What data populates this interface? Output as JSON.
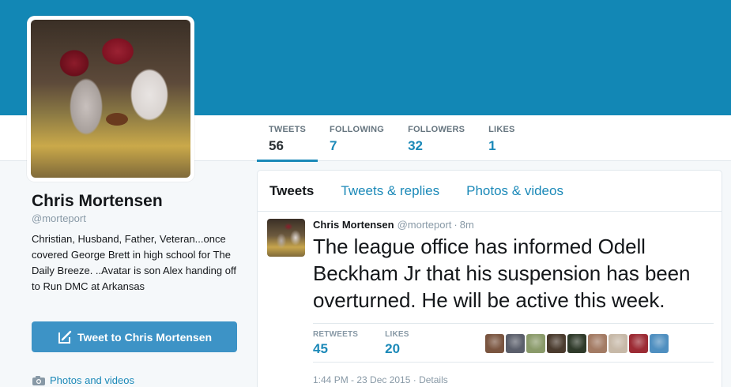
{
  "profile": {
    "name": "Chris Mortensen",
    "handle": "@morteport",
    "bio": "Christian, Husband, Father, Veteran...once covered George Brett in high school for The Daily Breeze. ..Avatar is son Alex handing off to Run DMC at Arkansas",
    "tweet_to_label": "Tweet to Chris Mortensen",
    "photos_link": "Photos and videos"
  },
  "stats": [
    {
      "label": "TWEETS",
      "value": "56"
    },
    {
      "label": "FOLLOWING",
      "value": "7"
    },
    {
      "label": "FOLLOWERS",
      "value": "32"
    },
    {
      "label": "LIKES",
      "value": "1"
    }
  ],
  "tabs": [
    {
      "label": "Tweets"
    },
    {
      "label": "Tweets & replies"
    },
    {
      "label": "Photos & videos"
    }
  ],
  "tweet": {
    "author": "Chris Mortensen",
    "handle": "@morteport",
    "separator": "·",
    "time": "8m",
    "text": "The league office has informed Odell Beckham Jr that his suspension has been overturned. He will be active this week.",
    "retweets_label": "RETWEETS",
    "retweets_value": "45",
    "likes_label": "LIKES",
    "likes_value": "20",
    "date": "1:44 PM - 23 Dec 2015",
    "date_sep": " · ",
    "details_label": "Details"
  },
  "colors": {
    "banner": "#1287b5",
    "accent": "#1b89b8",
    "button": "#3d93c6"
  },
  "liker_colors": [
    "#7a5540",
    "#5b5f6b",
    "#8a9a6a",
    "#4a3b2e",
    "#2f3a2a",
    "#a37b64",
    "#c7b9a8",
    "#9c2b34",
    "#4f8fc0"
  ]
}
